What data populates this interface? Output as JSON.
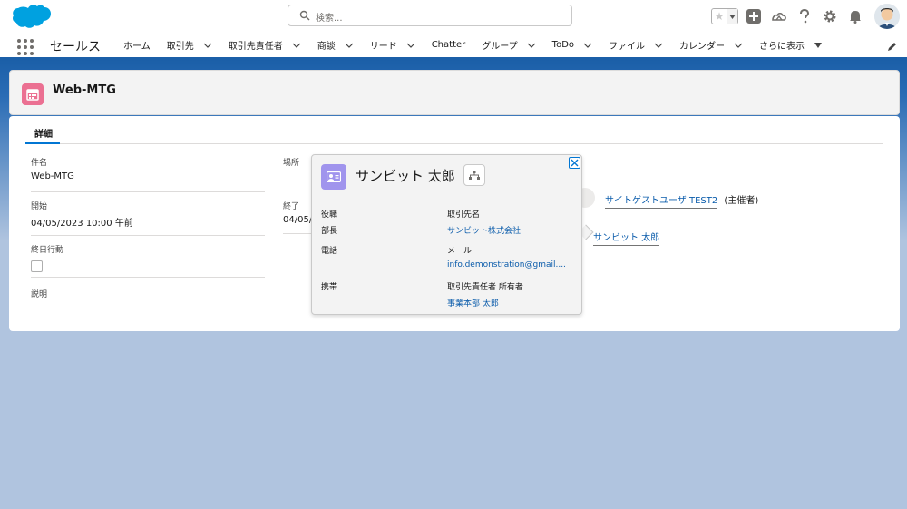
{
  "header": {
    "search_placeholder": "検索...",
    "avatar": "user-avatar"
  },
  "nav": {
    "app_name": "セールス",
    "items": [
      {
        "label": "ホーム",
        "dropdown": false
      },
      {
        "label": "取引先",
        "dropdown": true
      },
      {
        "label": "取引先責任者",
        "dropdown": true
      },
      {
        "label": "商談",
        "dropdown": true
      },
      {
        "label": "リード",
        "dropdown": true
      },
      {
        "label": "Chatter",
        "dropdown": false
      },
      {
        "label": "グループ",
        "dropdown": true
      },
      {
        "label": "ToDo",
        "dropdown": true
      },
      {
        "label": "ファイル",
        "dropdown": true
      },
      {
        "label": "カレンダー",
        "dropdown": true
      },
      {
        "label": "さらに表示",
        "dropdown": true
      }
    ]
  },
  "record": {
    "title": "Web-MTG",
    "icon": "calendar-icon"
  },
  "detail": {
    "tab_label": "詳細",
    "subject_label": "件名",
    "subject_value": "Web-MTG",
    "start_label": "開始",
    "start_value": "04/05/2023 10:00 午前",
    "allday_label": "終日行動",
    "description_label": "説明",
    "location_label": "場所",
    "end_label": "終了",
    "end_value": "04/05/",
    "attendee1_name": "サイトゲストユーザ TEST2",
    "attendee1_role": "(主催者)",
    "attendee2_name": "サンビット 太郎"
  },
  "popover": {
    "title": "サンビット 太郎",
    "title_label": "役職",
    "title_value": "部長",
    "account_label": "取引先名",
    "account_value": "サンビット株式会社",
    "phone_label": "電話",
    "email_label": "メール",
    "email_value": "info.demonstration@gmail....",
    "mobile_label": "携帯",
    "owner_label": "取引先責任者 所有者",
    "owner_value": "事業本部 太郎"
  },
  "colors": {
    "brand_blue": "#1b5fa8",
    "link": "#0b5cab",
    "event_icon": "#eb7092",
    "contact_icon": "#a094ed"
  }
}
